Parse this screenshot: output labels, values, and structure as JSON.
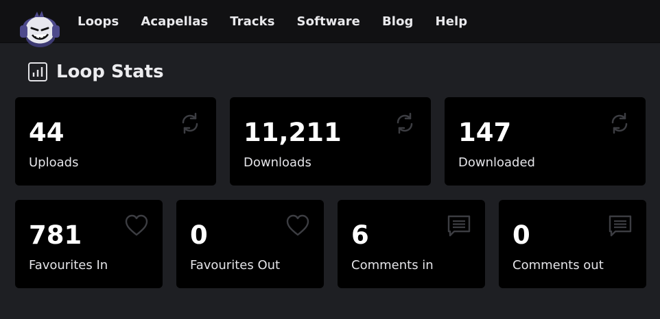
{
  "nav": {
    "items": [
      {
        "label": "Loops"
      },
      {
        "label": "Acapellas"
      },
      {
        "label": "Tracks"
      },
      {
        "label": "Software"
      },
      {
        "label": "Blog"
      },
      {
        "label": "Help"
      }
    ]
  },
  "page": {
    "title": "Loop Stats"
  },
  "stats": {
    "uploads": {
      "value": "44",
      "label": "Uploads",
      "icon": "refresh-icon"
    },
    "downloads": {
      "value": "11,211",
      "label": "Downloads",
      "icon": "refresh-icon"
    },
    "downloaded": {
      "value": "147",
      "label": "Downloaded",
      "icon": "refresh-icon"
    },
    "favourites_in": {
      "value": "781",
      "label": "Favourites In",
      "icon": "heart-icon"
    },
    "favourites_out": {
      "value": "0",
      "label": "Favourites Out",
      "icon": "heart-icon"
    },
    "comments_in": {
      "value": "6",
      "label": "Comments in",
      "icon": "comment-icon"
    },
    "comments_out": {
      "value": "0",
      "label": "Comments out",
      "icon": "comment-icon"
    }
  },
  "colors": {
    "background": "#1e1f23",
    "navbar": "#111113",
    "card": "#000000",
    "icon_muted": "#3c3d42",
    "logo_purple": "#4e4a8c"
  }
}
